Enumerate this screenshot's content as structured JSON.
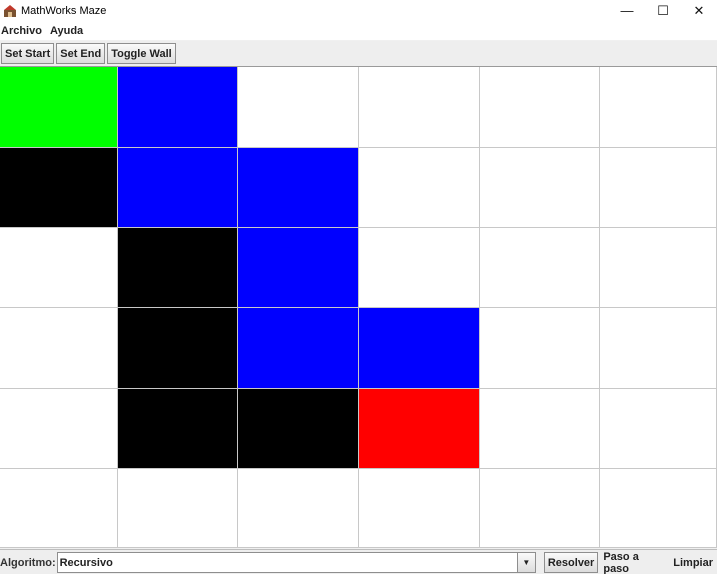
{
  "window": {
    "title": "MathWorks Maze",
    "minimize_glyph": "—",
    "maximize_glyph": "☐",
    "close_glyph": "✕"
  },
  "menu": {
    "items": [
      {
        "label": "Archivo"
      },
      {
        "label": "Ayuda"
      }
    ]
  },
  "toolbar": {
    "set_start_label": "Set Start",
    "set_end_label": "Set End",
    "toggle_wall_label": "Toggle Wall"
  },
  "maze": {
    "rows": 6,
    "cols": 6,
    "colors": {
      "empty": "#ffffff",
      "start": "#00ff00",
      "end": "#ff0000",
      "wall": "#000000",
      "path": "#0000ff"
    },
    "cells": [
      [
        "start",
        "path",
        "empty",
        "empty",
        "empty",
        "empty"
      ],
      [
        "wall",
        "path",
        "path",
        "empty",
        "empty",
        "empty"
      ],
      [
        "empty",
        "wall",
        "path",
        "empty",
        "empty",
        "empty"
      ],
      [
        "empty",
        "wall",
        "path",
        "path",
        "empty",
        "empty"
      ],
      [
        "empty",
        "wall",
        "wall",
        "end",
        "empty",
        "empty"
      ],
      [
        "empty",
        "empty",
        "empty",
        "empty",
        "empty",
        "empty"
      ]
    ]
  },
  "bottom": {
    "algorithm_label": "Algoritmo:",
    "algorithm_value": "Recursivo",
    "dropdown_glyph": "▼",
    "resolver_label": "Resolver",
    "step_label": "Paso a paso",
    "clear_label": "Limpiar"
  }
}
